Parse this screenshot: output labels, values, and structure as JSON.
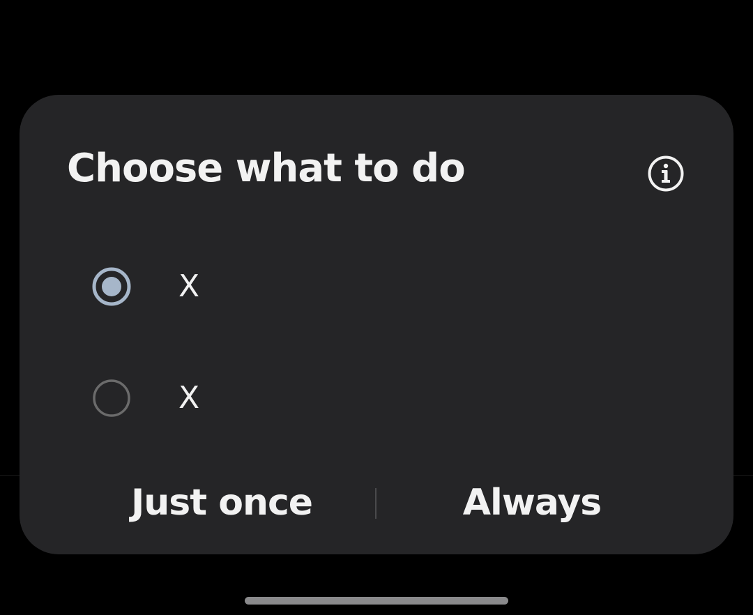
{
  "dialog": {
    "title": "Choose what to do",
    "info_icon": "info-circle-icon",
    "options": [
      {
        "label": "X",
        "selected": true
      },
      {
        "label": "X",
        "selected": false
      }
    ],
    "buttons": {
      "just_once": "Just once",
      "always": "Always"
    }
  },
  "colors": {
    "background": "#000000",
    "dialog": "#252527",
    "text": "#f2f2f2",
    "radio_selected": "#a6b6c9",
    "radio_unselected": "#6b6b6b"
  }
}
